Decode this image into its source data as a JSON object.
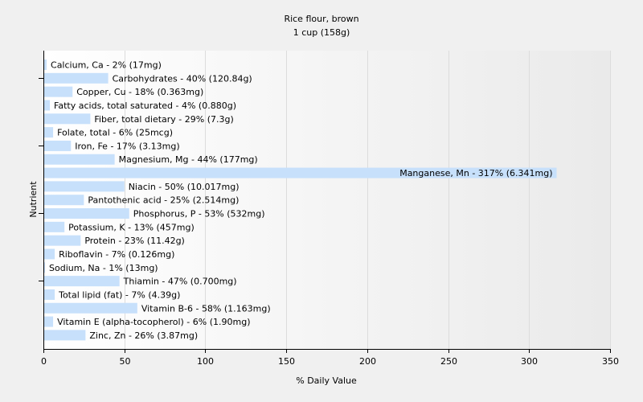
{
  "chart_data": {
    "type": "bar",
    "orientation": "horizontal",
    "title": "Rice flour, brown",
    "subtitle": "1 cup (158g)",
    "xlabel": "% Daily Value",
    "ylabel": "Nutrient",
    "xlim": [
      0,
      350
    ],
    "xticks": [
      "0",
      "50",
      "100",
      "150",
      "200",
      "250",
      "300",
      "350"
    ],
    "grid": true,
    "legend": "none",
    "bar_color": "#c7e0fb",
    "background": "#f0f0f0",
    "categories": [
      "Calcium, Ca",
      "Carbohydrates",
      "Copper, Cu",
      "Fatty acids, total saturated",
      "Fiber, total dietary",
      "Folate, total",
      "Iron, Fe",
      "Magnesium, Mg",
      "Manganese, Mn",
      "Niacin",
      "Pantothenic acid",
      "Phosphorus, P",
      "Potassium, K",
      "Protein",
      "Riboflavin",
      "Sodium, Na",
      "Thiamin",
      "Total lipid (fat)",
      "Vitamin B-6",
      "Vitamin E (alpha-tocopherol)",
      "Zinc, Zn"
    ],
    "values": [
      2,
      40,
      18,
      4,
      29,
      6,
      17,
      44,
      317,
      50,
      25,
      53,
      13,
      23,
      7,
      1,
      47,
      7,
      58,
      6,
      26
    ],
    "labels": [
      "Calcium, Ca - 2% (17mg)",
      "Carbohydrates - 40% (120.84g)",
      "Copper, Cu - 18% (0.363mg)",
      "Fatty acids, total saturated - 4% (0.880g)",
      "Fiber, total dietary - 29% (7.3g)",
      "Folate, total - 6% (25mcg)",
      "Iron, Fe - 17% (3.13mg)",
      "Magnesium, Mg - 44% (177mg)",
      "Manganese, Mn - 317% (6.341mg)",
      "Niacin - 50% (10.017mg)",
      "Pantothenic acid - 25% (2.514mg)",
      "Phosphorus, P - 53% (532mg)",
      "Potassium, K - 13% (457mg)",
      "Protein - 23% (11.42g)",
      "Riboflavin - 7% (0.126mg)",
      "Sodium, Na - 1% (13mg)",
      "Thiamin - 47% (0.700mg)",
      "Total lipid (fat) - 7% (4.39g)",
      "Vitamin B-6 - 58% (1.163mg)",
      "Vitamin E (alpha-tocopherol) - 6% (1.90mg)",
      "Zinc, Zn - 26% (3.87mg)"
    ]
  }
}
